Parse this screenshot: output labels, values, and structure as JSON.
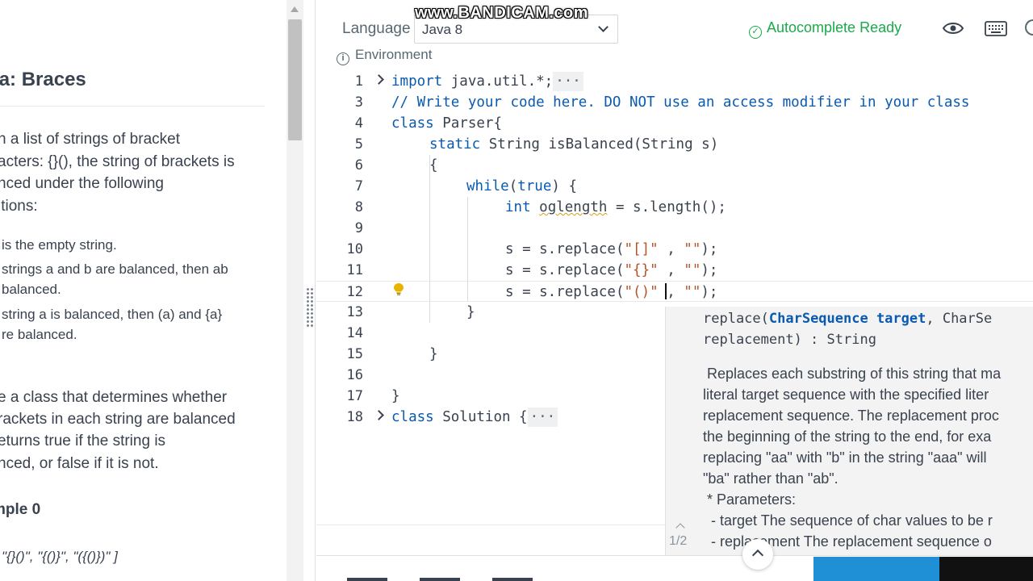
{
  "problem": {
    "title": "ava: Braces",
    "intro_lines": [
      "n a list of strings of bracket",
      "acters: {}(), the string of brackets is",
      "nced under the following",
      "itions:"
    ],
    "rules": [
      "is the empty string.",
      "strings a and b are balanced, then ab",
      "balanced.",
      "string a is balanced, then (a) and {a}",
      "re balanced."
    ],
    "task_lines": [
      "e a class that determines whether",
      "rackets in each string are balanced",
      "eturns true if the string is",
      "nced, or false if it is not."
    ],
    "sample_title": "mple 0",
    "sample_data": "\"{}()\", \"{()}\", \"({()})\" ]"
  },
  "header": {
    "language_label": "Language",
    "language_value": "Java 8",
    "environment_label": "Environment",
    "autocomplete_label": "Autocomplete Ready",
    "watermark": "www.BANDICAM.com"
  },
  "editor": {
    "line_numbers": [
      "1",
      "3",
      "4",
      "5",
      "6",
      "7",
      "8",
      "9",
      "10",
      "11",
      "12",
      "13",
      "14",
      "15",
      "16",
      "17",
      "18"
    ],
    "lines": {
      "l1_kw": "import",
      "l1_rest": " java.util.*;",
      "l1_fold": "···",
      "l3": "// Write your code here. DO NOT use an access modifier in your class",
      "l4_kw": "class",
      "l4_rest": " Parser{",
      "l5_kw": "static",
      "l5_rest": " String isBalanced(String s)",
      "l6": "{",
      "l7_kw": "while",
      "l7_a": "(",
      "l7_kw2": "true",
      "l7_b": ") {",
      "l8_kw": "int",
      "l8_a": " ",
      "l8_var": "oglength",
      "l8_b": " = s.length();",
      "l10_a": "s = s.replace(",
      "l10_s1": "\"[]\"",
      "l10_b": " , ",
      "l10_s2": "\"\"",
      "l10_c": ");",
      "l11_a": "s = s.replace(",
      "l11_s1": "\"{}\"",
      "l11_b": " , ",
      "l11_s2": "\"\"",
      "l11_c": ");",
      "l12_a": "s = s.replace(",
      "l12_s1": "\"()\"",
      "l12_b": " , ",
      "l12_s2": "\"\"",
      "l12_c": ");",
      "l13": "}",
      "l15": "}",
      "l17": "}",
      "l18_kw": "class",
      "l18_rest": " Solution {",
      "l18_fold": "···"
    }
  },
  "suggestion": {
    "sig_a": "replace(",
    "sig_param1": "CharSequence target",
    "sig_b": ", CharSe",
    "sig_line2": "replacement) : String",
    "doc_lines": [
      " Replaces each substring of this string that ma",
      "literal target sequence with the specified liter",
      "replacement sequence. The replacement proc",
      "the beginning of the string to the end, for exa",
      "replacing \"aa\" with \"b\" in the string \"aaa\" will",
      "\"ba\" rather than \"ab\".",
      " * Parameters:",
      "  - target The sequence of char values to be r",
      "  - replacement The replacement sequence o"
    ],
    "pager": "1/2"
  },
  "colors": {
    "accent_green": "#1ba94c",
    "keyword_blue": "#0a5ab0",
    "string_brown": "#b5532b",
    "run_button_blue": "#1f8fd6"
  },
  "icons": [
    "info-icon",
    "check-circle-icon",
    "eye-icon",
    "keyboard-icon",
    "chevron-down-icon",
    "lightbulb-icon",
    "chevron-up-icon",
    "fold-chevron-icon",
    "drag-grip-icon"
  ]
}
